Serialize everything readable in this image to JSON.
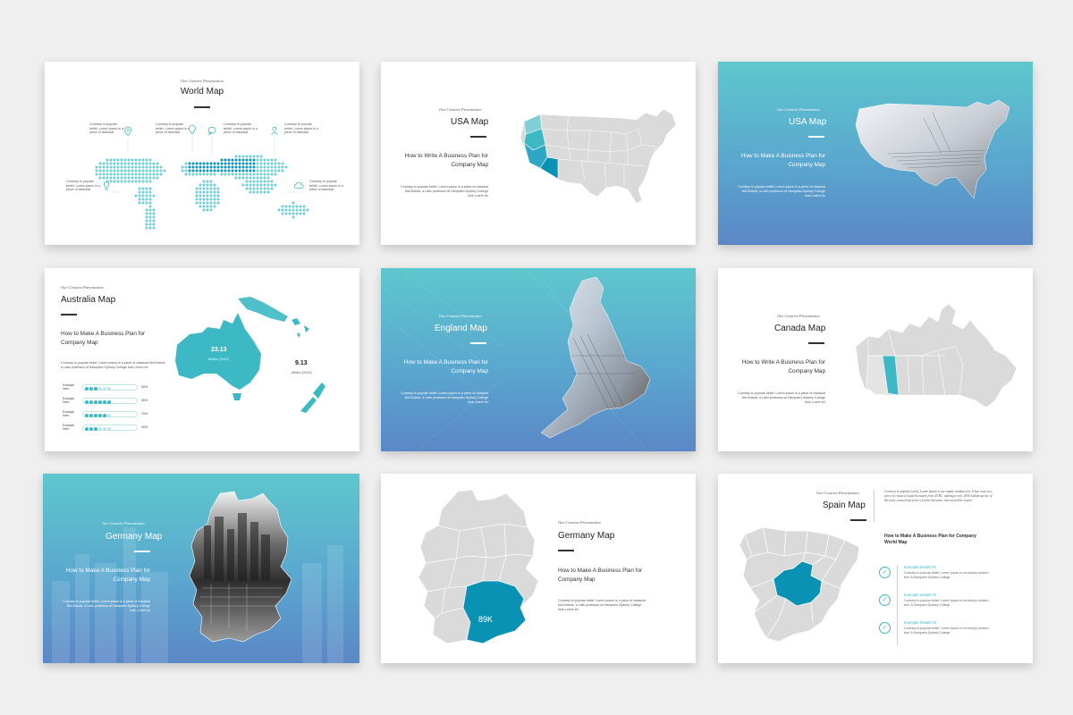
{
  "slides": {
    "world": {
      "subtitle": "Our Creative Presentation",
      "title": "World Map",
      "callout": "Contrary to popular belief, Lorem ipsum is a piece of classical",
      "icons": [
        "location-pin-icon",
        "location-pin-icon",
        "chat-icon",
        "user-icon",
        "trophy-icon",
        "cloud-icon"
      ]
    },
    "usa": {
      "subtitle": "Our Creative Presentation",
      "title": "USA Map",
      "heading": "How to Write A Business Plan for Company Map",
      "body": "Contrary to popular belief, Lorem ipsum is a piece of classical McClintock, a Latin professor at Hampden-Sydney College look Lorem for"
    },
    "usa2": {
      "subtitle": "Our Creative Presentation",
      "title": "USA Map",
      "heading": "How to Make A Business Plan for Company Map",
      "body": "Contrary to popular belief, Lorem ipsum is a piece of classical McClintock, a Latin professor at Hampden-Sydney College look Lorem for"
    },
    "australia": {
      "subtitle": "Our Creative Presentation",
      "title": "Australia Map",
      "heading": "How to Make A Business Plan for Company Map",
      "body": "Contrary to popular belief, Lorem ipsum is a piece of classical McClintock, a Latin professor at Hampden-Sydney College look Lorem for",
      "stat1_value": "23.13",
      "stat1_unit": "Million (2020)",
      "stat2_value": "9.13",
      "stat2_unit": "Million (2019)",
      "rows": [
        {
          "label": "Example Here",
          "pct_label": "50%",
          "filled": 3
        },
        {
          "label": "Example Here",
          "pct_label": "90%",
          "filled": 6
        },
        {
          "label": "Example Here",
          "pct_label": "70%",
          "filled": 5
        },
        {
          "label": "Example Here",
          "pct_label": "40%",
          "filled": 3
        }
      ]
    },
    "england": {
      "subtitle": "Our Creative Presentation",
      "title": "England Map",
      "heading": "How to Make A Business Plan for Company Map",
      "body": "Contrary to popular belief, Lorem ipsum is a piece of classical McClintock, a Latin professor at Hampden-Sydney College look Lorem for"
    },
    "canada": {
      "subtitle": "Our Creative Presentation",
      "title": "Canada Map",
      "heading": "How to Write A Business Plan for Company Map",
      "body": "Contrary to popular belief, Lorem ipsum is a piece of classical McClintock, a Latin professor at Hampden-Sydney College look Lorem for"
    },
    "germany1": {
      "subtitle": "Our Creative Presentation",
      "title": "Germany Map",
      "heading": "How to Make A Business Plan for Company Map",
      "body": "Contrary to popular belief, Lorem ipsum is a piece of classical McClintock, a Latin professor at Hampden-Sydney College look Lorem for"
    },
    "germany2": {
      "subtitle": "Our Creative Presentation",
      "title": "Germany Map",
      "heading": "How to Make A Business Plan for Company Map",
      "body": "Contrary to popular belief, Lorem ipsum is a piece of classical McClintock, a Latin professor at Hampden-Sydney College look Lorem for",
      "region_value": "89K"
    },
    "spain": {
      "subtitle": "Our Creative Presentation",
      "title": "Spain Map",
      "intro": "Contrary to popular belief, Lorem Ipsum is not simply random text. It has roots in a piece of classical Latin literature from 45 BC, making it over 2000 looked up one of the more consectetur, from a Lorem literature, discovered the source.",
      "heading": "How to Make A Business Plan for Company World Map",
      "details": [
        {
          "title": "Example Details #1",
          "text": "Contrary to popular belief, Lorem ipsum is not simply random text. A Hampden-Sydney College"
        },
        {
          "title": "Example Details #2",
          "text": "Contrary to popular belief, Lorem ipsum is not simply random text. A Hampden-Sydney College"
        },
        {
          "title": "Example Details #3",
          "text": "Contrary to popular belief, Lorem ipsum is not simply random text. A Hampden-Sydney College"
        }
      ]
    }
  },
  "colors": {
    "accent": "#3cb9c4",
    "accent_dark": "#0a92b4",
    "map_gray": "#dadada",
    "gradient_top": "#5ec7cd",
    "gradient_bottom": "#5b87c6"
  }
}
